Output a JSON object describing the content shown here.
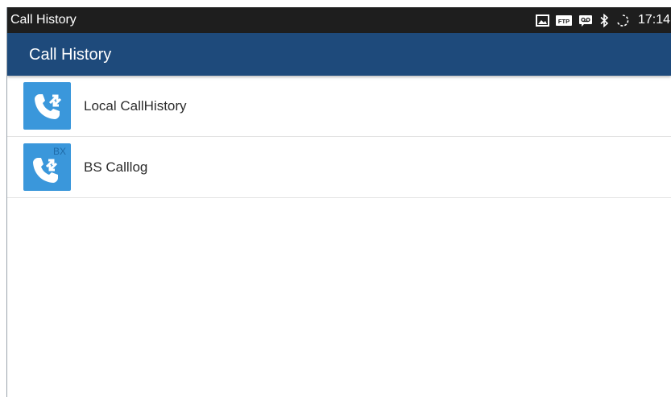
{
  "status_bar": {
    "title": "Call History",
    "time": "17:14",
    "icons": [
      "image-icon",
      "ftp-icon",
      "voicemail-icon",
      "bluetooth-icon",
      "sync-icon"
    ],
    "ftp_text": "FTP"
  },
  "app_bar": {
    "title": "Call History"
  },
  "list": {
    "items": [
      {
        "label": "Local CallHistory",
        "icon": "local-call-history-icon"
      },
      {
        "label": "BS Calllog",
        "icon": "bs-calllog-icon",
        "badge": "BX"
      }
    ]
  },
  "colors": {
    "status_bar_bg": "#1e1e1e",
    "app_bar_bg": "#1e4a7b",
    "icon_bg": "#3a97db"
  }
}
